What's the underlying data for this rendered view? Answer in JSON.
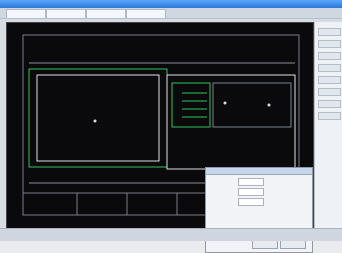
{
  "window": {
    "title": ""
  },
  "tabs": [
    {
      "label": ""
    },
    {
      "label": ""
    },
    {
      "label": ""
    },
    {
      "label": ""
    }
  ],
  "sidebar": {
    "buttons": [
      {
        "label": ""
      },
      {
        "label": ""
      },
      {
        "label": ""
      },
      {
        "label": ""
      },
      {
        "label": ""
      },
      {
        "label": ""
      },
      {
        "label": ""
      },
      {
        "label": ""
      }
    ]
  },
  "dialog": {
    "title": "",
    "lines": [
      "",
      "",
      "",
      "",
      "",
      ""
    ],
    "ok_label": "",
    "cancel_label": ""
  },
  "statusbar": {
    "left": "",
    "right": ""
  },
  "colors": {
    "canvas": "#0a0a0d",
    "cad_green": "#38c95b",
    "cad_white": "#d9d9d9",
    "cad_gray": "#8a8f96"
  }
}
